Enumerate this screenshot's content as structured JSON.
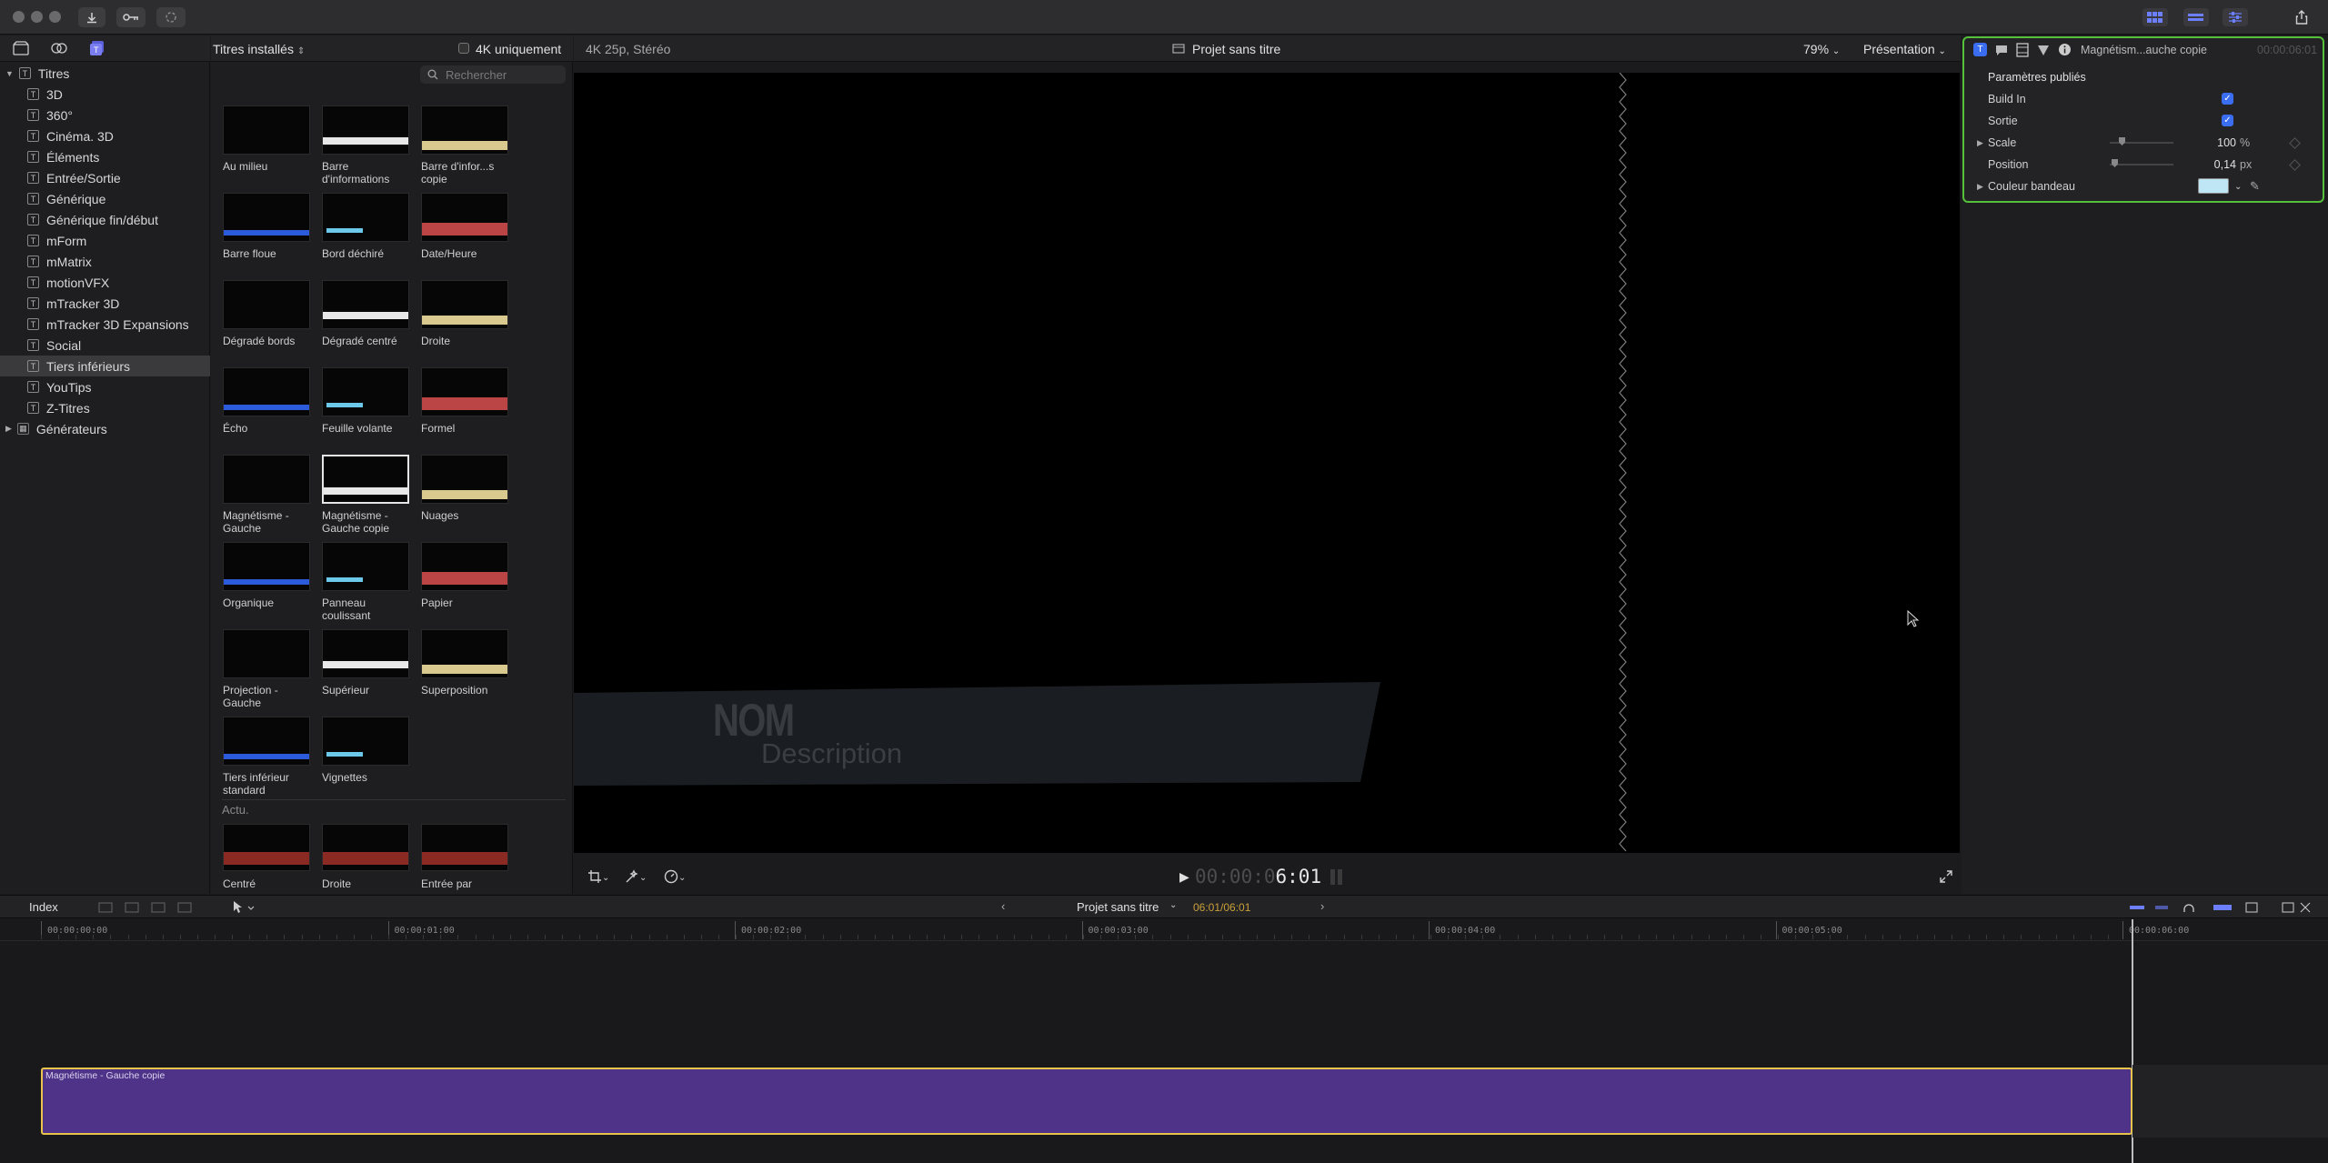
{
  "titlebar": {
    "buttons": [
      "import",
      "keywords",
      "background-tasks"
    ]
  },
  "sidebar": {
    "header_label": "Titres",
    "items": [
      {
        "label": "3D"
      },
      {
        "label": "360°"
      },
      {
        "label": "Cinéma. 3D"
      },
      {
        "label": "Éléments"
      },
      {
        "label": "Entrée/Sortie"
      },
      {
        "label": "Générique"
      },
      {
        "label": "Générique fin/début"
      },
      {
        "label": "mForm"
      },
      {
        "label": "mMatrix"
      },
      {
        "label": "motionVFX"
      },
      {
        "label": "mTracker 3D"
      },
      {
        "label": "mTracker 3D Expansions"
      },
      {
        "label": "Social"
      },
      {
        "label": "Tiers inférieurs",
        "selected": true
      },
      {
        "label": "YouTips"
      },
      {
        "label": "Z-Titres"
      }
    ],
    "generators_label": "Générateurs"
  },
  "browser": {
    "title": "Titres installés",
    "checkbox_4k": "4K uniquement",
    "search_placeholder": "Rechercher",
    "items": [
      {
        "label": "Au milieu"
      },
      {
        "label": "Barre d'informations"
      },
      {
        "label": "Barre d'infor...s copie"
      },
      {
        "label": "Barre floue"
      },
      {
        "label": "Bord déchiré"
      },
      {
        "label": "Date/Heure"
      },
      {
        "label": "Dégradé bords"
      },
      {
        "label": "Dégradé centré"
      },
      {
        "label": "Droite"
      },
      {
        "label": "Écho"
      },
      {
        "label": "Feuille volante"
      },
      {
        "label": "Formel"
      },
      {
        "label": "Magnétisme - Gauche"
      },
      {
        "label": "Magnétisme - Gauche copie",
        "selected": true
      },
      {
        "label": "Nuages"
      },
      {
        "label": "Organique"
      },
      {
        "label": "Panneau coulissant"
      },
      {
        "label": "Papier"
      },
      {
        "label": "Projection - Gauche"
      },
      {
        "label": "Supérieur"
      },
      {
        "label": "Superposition"
      },
      {
        "label": "Tiers inférieur standard"
      },
      {
        "label": "Vignettes"
      }
    ],
    "section_label": "Actu.",
    "section_items": [
      {
        "label": "Centré"
      },
      {
        "label": "Droite"
      },
      {
        "label": "Entrée par"
      }
    ]
  },
  "viewer": {
    "format": "4K 25p, Stéréo",
    "project_title": "Projet sans titre",
    "zoom": "79%",
    "view_menu": "Présentation",
    "overlay_name": "NOM",
    "overlay_description": "Description",
    "timecode_dim": "00:00:0",
    "timecode_bright": "6:01"
  },
  "inspector": {
    "clip_name": "Magnétism...auche copie",
    "clip_time": "00:00:06:01",
    "section_title": "Paramètres publiés",
    "params": [
      {
        "label": "Build In",
        "type": "checkbox",
        "checked": true
      },
      {
        "label": "Sortie",
        "type": "checkbox",
        "checked": true
      },
      {
        "label": "Scale",
        "type": "slider",
        "value": "100",
        "unit": "%",
        "expandable": true
      },
      {
        "label": "Position",
        "type": "slider",
        "value": "0,14",
        "unit": "px"
      },
      {
        "label": "Couleur bandeau",
        "type": "color",
        "expandable": true,
        "color": "#bfe6f5"
      }
    ]
  },
  "timeline": {
    "index_label": "Index",
    "project_title": "Projet sans titre",
    "duration": "06:01/06:01",
    "ruler": [
      "00:00:00:00",
      "00:00:01:00",
      "00:00:02:00",
      "00:00:03:00",
      "00:00:04:00",
      "00:00:05:00",
      "00:00:06:00"
    ],
    "clip_label": "Magnétisme - Gauche copie"
  },
  "colors": {
    "accent_green": "#55c13a",
    "clip_purple": "#4f3388",
    "clip_border": "#e8c44b",
    "checkbox_blue": "#3b6df2"
  }
}
